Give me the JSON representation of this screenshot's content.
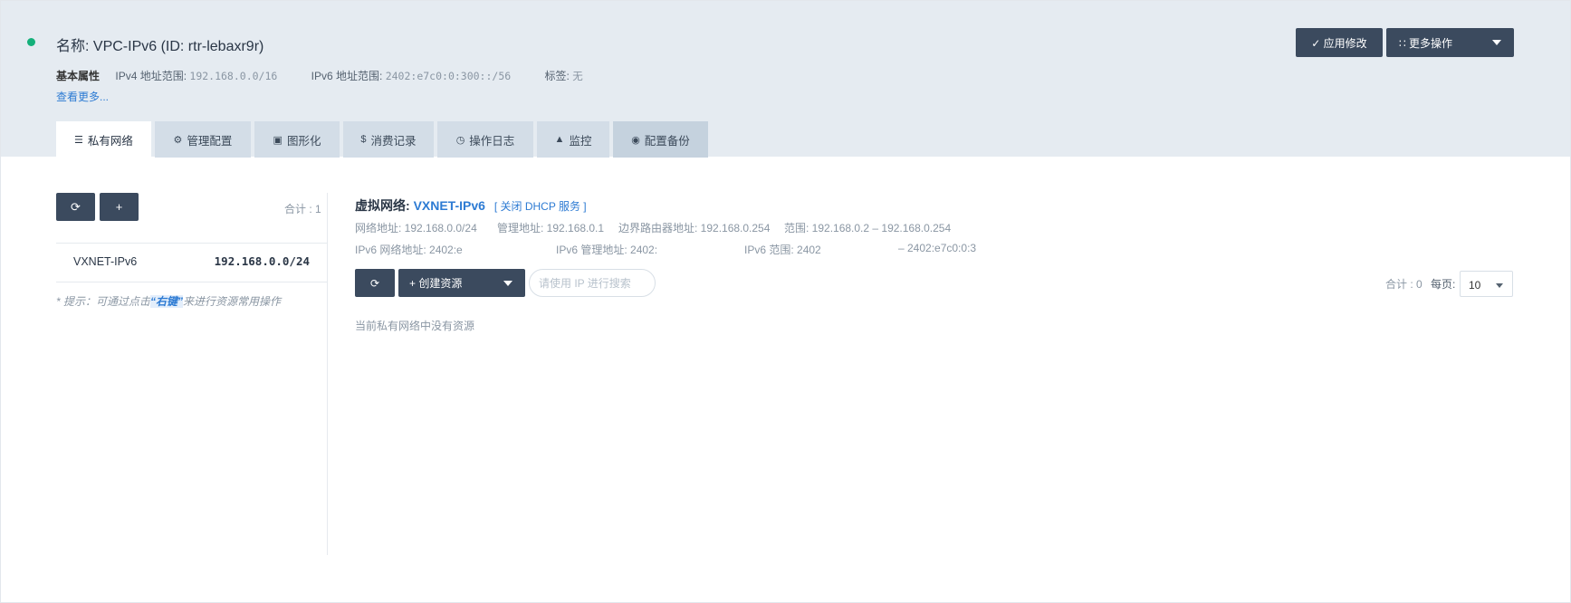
{
  "header": {
    "title": "名称: VPC-IPv6 (ID: rtr-lebaxr9r)",
    "basic_label": "基本属性",
    "ipv4_label": "IPv4 地址范围:",
    "ipv4_value": "192.168.0.0/16",
    "ipv6_label": "IPv6 地址范围:",
    "ipv6_value": "2402:e7c0:0:300::/56",
    "tags_label": "标签:",
    "tags_value": "无",
    "see_more": "查看更多...",
    "apply_label": "✓ 应用修改",
    "more_label": "∷ 更多操作",
    "status_color": "#14b07a"
  },
  "tabs": [
    {
      "icon": "☰",
      "label": "私有网络"
    },
    {
      "icon": "⚙",
      "label": "管理配置"
    },
    {
      "icon": "▣",
      "label": "图形化"
    },
    {
      "icon": "$",
      "label": "消费记录"
    },
    {
      "icon": "◷",
      "label": "操作日志"
    },
    {
      "icon": "▲",
      "label": "监控"
    },
    {
      "icon": "◉",
      "label": "配置备份"
    }
  ],
  "left": {
    "refresh_icon": "⟳",
    "add_icon": "+",
    "total": "合计 : 1",
    "items": [
      {
        "name": "VXNET-IPv6",
        "ip": "192.168.0.0/24"
      }
    ],
    "hint_prefix": "* 提示：可通过点击",
    "hint_highlight": "“右键”",
    "hint_suffix": "来进行资源常用操作"
  },
  "vnet": {
    "label": "虚拟网络:",
    "name": "VXNET-IPv6",
    "dhcp": "[ 关闭 DHCP 服务 ]",
    "row1": [
      "网络地址: 192.168.0.0/24",
      "管理地址: 192.168.0.1",
      "边界路由器地址: 192.168.0.254",
      "范围: 192.168.0.2 – 192.168.0.254"
    ],
    "row2": [
      "IPv6 网络地址: 2402:e",
      "IPv6 管理地址: 2402:",
      "IPv6 范围: 2402",
      "– 2402:e7c0:0:3"
    ]
  },
  "toolbar": {
    "refresh_icon": "⟳",
    "create_label": "+ 创建资源",
    "search_placeholder": "请使用 IP 进行搜索",
    "total": "合计 : 0",
    "per_page_label": "每页:",
    "per_page_value": "10"
  },
  "empty_text": "当前私有网络中没有资源"
}
